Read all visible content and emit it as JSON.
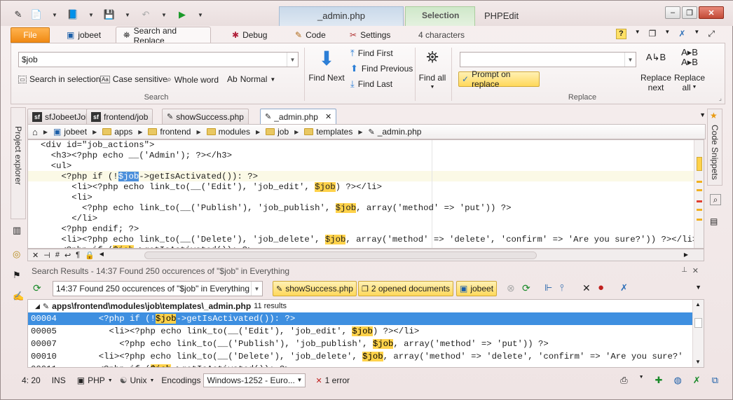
{
  "window": {
    "doc_title": "_admin.php",
    "context_tab": "Selection",
    "app_title": "PHPEdit"
  },
  "ribbon_tabs": [
    {
      "label": "File"
    },
    {
      "label": "jobeet"
    },
    {
      "label": "Search and Replace"
    },
    {
      "label": "Debug"
    },
    {
      "label": "Code"
    },
    {
      "label": "Settings"
    },
    {
      "label": "4 characters"
    }
  ],
  "search": {
    "query": "$job",
    "search_in_selection": "Search in selection",
    "case_sensitive": "Case sensitive",
    "whole_word": "Whole word",
    "mode": "Normal",
    "find_next": "Find Next",
    "find_first": "Find First",
    "find_previous": "Find Previous",
    "find_last": "Find Last",
    "find_all": "Find all",
    "group_label": "Search"
  },
  "replace": {
    "value": "",
    "prompt_on_replace": "Prompt on replace",
    "replace_next_1": "Replace",
    "replace_next_2": "next",
    "replace_all_1": "Replace",
    "replace_all_2": "all",
    "group_label": "Replace"
  },
  "side_panels": {
    "left": "Project explorer",
    "right": "Code Snippets"
  },
  "doc_tabs": [
    {
      "label": "sfJobeetJob"
    },
    {
      "label": "frontend/job"
    },
    {
      "label": "showSuccess.php"
    },
    {
      "label": "_admin.php"
    }
  ],
  "breadcrumb": [
    "jobeet",
    "apps",
    "frontend",
    "modules",
    "job",
    "templates",
    "_admin.php"
  ],
  "code_lines": [
    {
      "ind": "",
      "a": "<div id=\"job_actions\">",
      "h": "",
      "b": ""
    },
    {
      "ind": "  ",
      "a": "<h3><?php echo __('Admin'); ?></h3>",
      "h": "",
      "b": ""
    },
    {
      "ind": "  ",
      "a": "<ul>",
      "h": "",
      "b": ""
    },
    {
      "ind": "    ",
      "a": "<?php if (!",
      "h": "$job",
      "b": "->getIsActivated()): ?>"
    },
    {
      "ind": "      ",
      "a": "<li><?php echo link_to(__('Edit'), 'job_edit', ",
      "h": "$job",
      "b": ") ?></li>"
    },
    {
      "ind": "      ",
      "a": "<li>",
      "h": "",
      "b": ""
    },
    {
      "ind": "        ",
      "a": "<?php echo link_to(__('Publish'), 'job_publish', ",
      "h": "$job",
      "b": ", array('method' => 'put')) ?>"
    },
    {
      "ind": "      ",
      "a": "</li>",
      "h": "",
      "b": ""
    },
    {
      "ind": "    ",
      "a": "<?php endif; ?>",
      "h": "",
      "b": ""
    },
    {
      "ind": "    ",
      "a": "<li><?php echo link_to(__('Delete'), 'job_delete', ",
      "h": "$job",
      "b": ", array('method' => 'delete', 'confirm' => 'Are you sure?')) ?></li>"
    },
    {
      "ind": "    ",
      "a": "<?php if (",
      "h": "$job",
      "b": "->getIsActivated()): ?>"
    }
  ],
  "results": {
    "panel_title": "Search Results - 14:37 Found 250 occurences of \"$job\" in Everything",
    "combo": "14:37 Found 250 occurences of \"$job\" in Everything",
    "scope_1": "showSuccess.php",
    "scope_2": "2 opened documents",
    "scope_3": "jobeet",
    "file_path": "apps\\frontend\\modules\\job\\templates\\_admin.php",
    "file_count": "11 results",
    "rows": [
      {
        "num": "00004",
        "ind": "  ",
        "a": "<?php if (!",
        "h": "$job",
        "b": "->getIsActivated()): ?>"
      },
      {
        "num": "00005",
        "ind": "    ",
        "a": "<li><?php echo link_to(__('Edit'), 'job_edit', ",
        "h": "$job",
        "b": ") ?></li>"
      },
      {
        "num": "00007",
        "ind": "      ",
        "a": "<?php echo link_to(__('Publish'), 'job_publish', ",
        "h": "$job",
        "b": ", array('method' => 'put')) ?>"
      },
      {
        "num": "00010",
        "ind": "  ",
        "a": "<li><?php echo link_to(__('Delete'), 'job_delete', ",
        "h": "$job",
        "b": ", array('method' => 'delete', 'confirm' => 'Are you sure?'"
      },
      {
        "num": "00011",
        "ind": "  ",
        "a": "<?php if (",
        "h": "$job",
        "b": "->getIsActivated()): ?>"
      }
    ]
  },
  "status": {
    "position": "4: 20",
    "mode": "INS",
    "language": "PHP",
    "line_endings": "Unix",
    "encodings_label": "Encodings",
    "encoding": "Windows-1252 - Euro...",
    "errors": "1 error"
  },
  "colors": {
    "accent": "#f08a14",
    "match": "#ffd24a",
    "selection": "#3e8fe0"
  }
}
